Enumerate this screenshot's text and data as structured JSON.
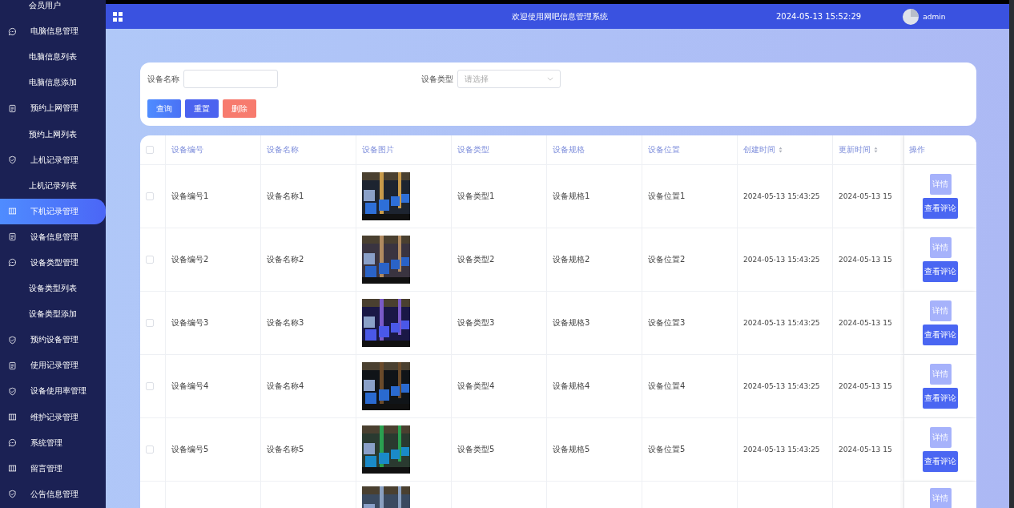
{
  "sidebar": {
    "items": [
      {
        "label": "会员用户",
        "kind": "sub",
        "selected": false
      },
      {
        "label": "电脑信息管理",
        "kind": "chat",
        "selected": false
      },
      {
        "label": "电脑信息列表",
        "kind": "sub",
        "selected": false
      },
      {
        "label": "电脑信息添加",
        "kind": "sub",
        "selected": false
      },
      {
        "label": "预约上网管理",
        "kind": "doc",
        "selected": false
      },
      {
        "label": "预约上网列表",
        "kind": "sub",
        "selected": false
      },
      {
        "label": "上机记录管理",
        "kind": "shield",
        "selected": false
      },
      {
        "label": "上机记录列表",
        "kind": "sub",
        "selected": false
      },
      {
        "label": "下机记录管理",
        "kind": "columns",
        "selected": true
      },
      {
        "label": "设备信息管理",
        "kind": "doc",
        "selected": false
      },
      {
        "label": "设备类型管理",
        "kind": "chat",
        "selected": false
      },
      {
        "label": "设备类型列表",
        "kind": "sub",
        "selected": false
      },
      {
        "label": "设备类型添加",
        "kind": "sub",
        "selected": false
      },
      {
        "label": "预约设备管理",
        "kind": "shield",
        "selected": false
      },
      {
        "label": "使用记录管理",
        "kind": "doc",
        "selected": false
      },
      {
        "label": "设备使用率管理",
        "kind": "shield",
        "selected": false
      },
      {
        "label": "维护记录管理",
        "kind": "columns",
        "selected": false
      },
      {
        "label": "系统管理",
        "kind": "chat",
        "selected": false
      },
      {
        "label": "留言管理",
        "kind": "columns",
        "selected": false
      },
      {
        "label": "公告信息管理",
        "kind": "shield",
        "selected": false
      }
    ]
  },
  "header": {
    "title": "欢迎使用网吧信息管理系统",
    "time": "2024-05-13 15:52:29",
    "user": "admin"
  },
  "search": {
    "fields": [
      {
        "label": "设备名称",
        "kind": "input"
      },
      {
        "label": "设备类型",
        "kind": "select",
        "placeholder": "请选择"
      }
    ],
    "buttons": [
      {
        "label": "查询",
        "kind": "search"
      },
      {
        "label": "重置",
        "kind": "reset"
      },
      {
        "label": "删除",
        "kind": "delete"
      }
    ]
  },
  "table": {
    "select_all_checked": false,
    "columns": [
      {
        "label": "设备编号",
        "sortable": false
      },
      {
        "label": "设备名称",
        "sortable": false
      },
      {
        "label": "设备图片",
        "sortable": false
      },
      {
        "label": "设备类型",
        "sortable": false
      },
      {
        "label": "设备规格",
        "sortable": false
      },
      {
        "label": "设备位置",
        "sortable": false
      },
      {
        "label": "创建时间",
        "sortable": true
      },
      {
        "label": "更新时间",
        "sortable": true
      }
    ],
    "action_header": "操作",
    "rows": [
      {
        "checked": false,
        "cells": [
          "设备编号1",
          "设备名称1",
          null,
          "设备类型1",
          "设备规格1",
          "设备位置1",
          "2024-05-13 15:43:25",
          "2024-05-13 15"
        ],
        "actions": [
          "详情",
          "查看评论"
        ]
      },
      {
        "checked": false,
        "cells": [
          "设备编号2",
          "设备名称2",
          null,
          "设备类型2",
          "设备规格2",
          "设备位置2",
          "2024-05-13 15:43:25",
          "2024-05-13 15"
        ],
        "actions": [
          "详情",
          "查看评论"
        ]
      },
      {
        "checked": false,
        "cells": [
          "设备编号3",
          "设备名称3",
          null,
          "设备类型3",
          "设备规格3",
          "设备位置3",
          "2024-05-13 15:43:25",
          "2024-05-13 15"
        ],
        "actions": [
          "详情",
          "查看评论"
        ]
      },
      {
        "checked": false,
        "cells": [
          "设备编号4",
          "设备名称4",
          null,
          "设备类型4",
          "设备规格4",
          "设备位置4",
          "2024-05-13 15:43:25",
          "2024-05-13 15"
        ],
        "actions": [
          "详情",
          "查看评论"
        ]
      },
      {
        "checked": false,
        "cells": [
          "设备编号5",
          "设备名称5",
          null,
          "设备类型5",
          "设备规格5",
          "设备位置5",
          "2024-05-13 15:43:25",
          "2024-05-13 15"
        ],
        "actions": [
          "详情",
          "查看评论"
        ]
      },
      {
        "actions": [
          "详情"
        ]
      }
    ]
  }
}
